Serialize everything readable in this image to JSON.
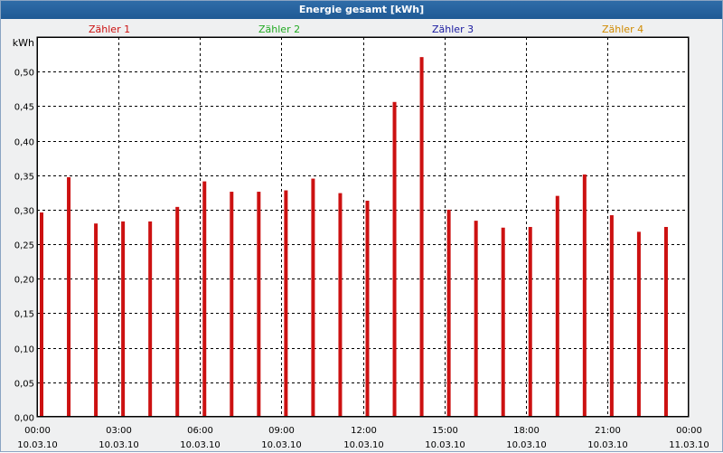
{
  "window": {
    "title": "Energie gesamt [kWh]"
  },
  "legend": [
    {
      "label": "Zähler 1",
      "color": "#cc1111"
    },
    {
      "label": "Zähler 2",
      "color": "#22aa22"
    },
    {
      "label": "Zähler 3",
      "color": "#1a1aa0"
    },
    {
      "label": "Zähler 4",
      "color": "#d08a00"
    }
  ],
  "chart_data": {
    "type": "bar",
    "ylabel": "kWh",
    "ylim": [
      0,
      0.55
    ],
    "yticks": [
      "0,00",
      "0,05",
      "0,10",
      "0,15",
      "0,20",
      "0,25",
      "0,30",
      "0,35",
      "0,40",
      "0,45",
      "0,50"
    ],
    "xticks": [
      {
        "time": "00:00",
        "date": "10.03.10"
      },
      {
        "time": "03:00",
        "date": "10.03.10"
      },
      {
        "time": "06:00",
        "date": "10.03.10"
      },
      {
        "time": "09:00",
        "date": "10.03.10"
      },
      {
        "time": "12:00",
        "date": "10.03.10"
      },
      {
        "time": "15:00",
        "date": "10.03.10"
      },
      {
        "time": "18:00",
        "date": "10.03.10"
      },
      {
        "time": "21:00",
        "date": "10.03.10"
      },
      {
        "time": "00:00",
        "date": "11.03.10"
      }
    ],
    "x_hours": [
      0,
      1,
      2,
      3,
      4,
      5,
      6,
      7,
      8,
      9,
      10,
      11,
      12,
      13,
      14,
      15,
      16,
      17,
      18,
      19,
      20,
      21,
      22,
      23
    ],
    "series": [
      {
        "name": "Zähler 1",
        "color": "#cc1111",
        "values": [
          0.296,
          0.347,
          0.28,
          0.283,
          0.283,
          0.304,
          0.341,
          0.326,
          0.326,
          0.328,
          0.345,
          0.324,
          0.313,
          0.456,
          0.521,
          0.3,
          0.284,
          0.274,
          0.275,
          0.32,
          0.351,
          0.292,
          0.268,
          0.275
        ]
      }
    ],
    "grid": true
  }
}
